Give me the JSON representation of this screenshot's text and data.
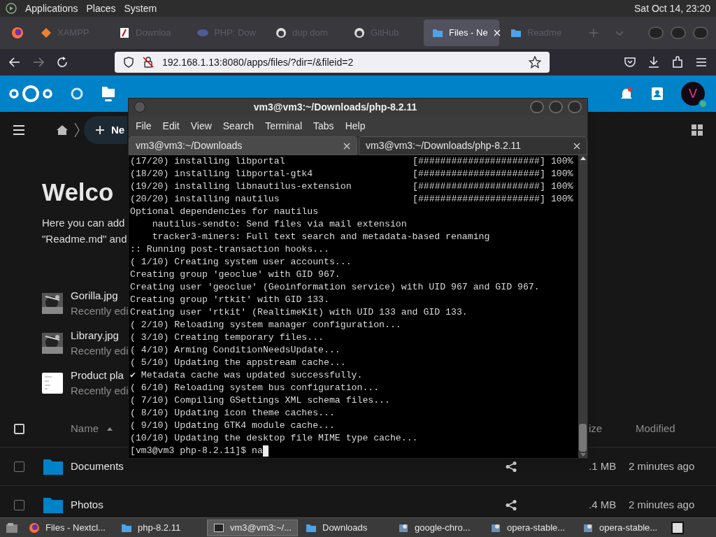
{
  "top_panel": {
    "menus": [
      "Applications",
      "Places",
      "System"
    ],
    "clock": "Sat Oct 14, 23:20"
  },
  "browser": {
    "tabs": [
      {
        "label": "XAMPP",
        "selected": false
      },
      {
        "label": "Downloa",
        "selected": false
      },
      {
        "label": "PHP: Dow",
        "selected": false
      },
      {
        "label": "dup dom",
        "selected": false
      },
      {
        "label": "GitHub",
        "selected": false
      },
      {
        "label": "Files - Ne",
        "selected": true
      },
      {
        "label": "Readme",
        "selected": false
      }
    ],
    "url": "192.168.1.13:8080/apps/files/?dir=/&fileid=2"
  },
  "nextcloud": {
    "avatar": "V",
    "new_button": "Ne",
    "heading": "Welco",
    "intro": [
      "Here you can add",
      "\"Readme.md\" and"
    ],
    "recent": [
      {
        "name": "Gorilla.jpg",
        "subtitle": "Recently edi"
      },
      {
        "name": "Library.jpg",
        "subtitle": "Recently edi"
      },
      {
        "name": "Product pla",
        "subtitle": "Recently edi"
      }
    ],
    "table": {
      "all_selected": false,
      "columns": [
        "Name",
        "ize",
        "Modified"
      ],
      "rows": [
        {
          "name": "Documents",
          "size": ".1 MB",
          "modified": "2 minutes ago",
          "checked": false
        },
        {
          "name": "Photos",
          "size": ".4 MB",
          "modified": "2 minutes ago",
          "checked": false
        }
      ]
    }
  },
  "terminal": {
    "title": "vm3@vm3:~/Downloads/php-8.2.11",
    "menus": [
      "File",
      "Edit",
      "View",
      "Search",
      "Terminal",
      "Tabs",
      "Help"
    ],
    "tabs": [
      {
        "label": "vm3@vm3:~/Downloads",
        "selected": false
      },
      {
        "label": "vm3@vm3:~/Downloads/php-8.2.11",
        "selected": true
      }
    ],
    "lines": [
      {
        "kind": "progress",
        "text": "(17/20) installing libportal",
        "bar": "[######################]",
        "percent": "100%"
      },
      {
        "kind": "progress",
        "text": "(18/20) installing libportal-gtk4",
        "bar": "[######################]",
        "percent": "100%"
      },
      {
        "kind": "progress",
        "text": "(19/20) installing libnautilus-extension",
        "bar": "[######################]",
        "percent": "100%"
      },
      {
        "kind": "progress",
        "text": "(20/20) installing nautilus",
        "bar": "[######################]",
        "percent": "100%"
      },
      {
        "kind": "text",
        "text": "Optional dependencies for nautilus"
      },
      {
        "kind": "text",
        "text": "    nautilus-sendto: Send files via mail extension"
      },
      {
        "kind": "text",
        "text": "    tracker3-miners: Full text search and metadata-based renaming"
      },
      {
        "kind": "text",
        "text": ":: Running post-transaction hooks..."
      },
      {
        "kind": "text",
        "text": "( 1/10) Creating system user accounts..."
      },
      {
        "kind": "text",
        "text": "Creating group 'geoclue' with GID 967."
      },
      {
        "kind": "text",
        "text": "Creating user 'geoclue' (Geoinformation service) with UID 967 and GID 967."
      },
      {
        "kind": "text",
        "text": "Creating group 'rtkit' with GID 133."
      },
      {
        "kind": "text",
        "text": "Creating user 'rtkit' (RealtimeKit) with UID 133 and GID 133."
      },
      {
        "kind": "text",
        "text": "( 2/10) Reloading system manager configuration..."
      },
      {
        "kind": "text",
        "text": "( 3/10) Creating temporary files..."
      },
      {
        "kind": "text",
        "text": "( 4/10) Arming ConditionNeedsUpdate..."
      },
      {
        "kind": "text",
        "text": "( 5/10) Updating the appstream cache..."
      },
      {
        "kind": "text",
        "text": "✔ Metadata cache was updated successfully."
      },
      {
        "kind": "text",
        "text": "( 6/10) Reloading system bus configuration..."
      },
      {
        "kind": "text",
        "text": "( 7/10) Compiling GSettings XML schema files..."
      },
      {
        "kind": "text",
        "text": "( 8/10) Updating icon theme caches..."
      },
      {
        "kind": "text",
        "text": "( 9/10) Updating GTK4 module cache..."
      },
      {
        "kind": "text",
        "text": "(10/10) Updating the desktop file MIME type cache..."
      },
      {
        "kind": "prompt",
        "text": "[vm3@vm3 php-8.2.11]$ na"
      }
    ]
  },
  "taskbar": [
    {
      "label": "Files - Nextcl...",
      "selected": false
    },
    {
      "label": "php-8.2.11",
      "selected": false
    },
    {
      "label": "vm3@vm3:~/...",
      "selected": true
    },
    {
      "label": "Downloads",
      "selected": false
    },
    {
      "label": "google-chro...",
      "selected": false
    },
    {
      "label": "opera-stable...",
      "selected": false
    },
    {
      "label": "opera-stable...",
      "selected": false
    }
  ]
}
